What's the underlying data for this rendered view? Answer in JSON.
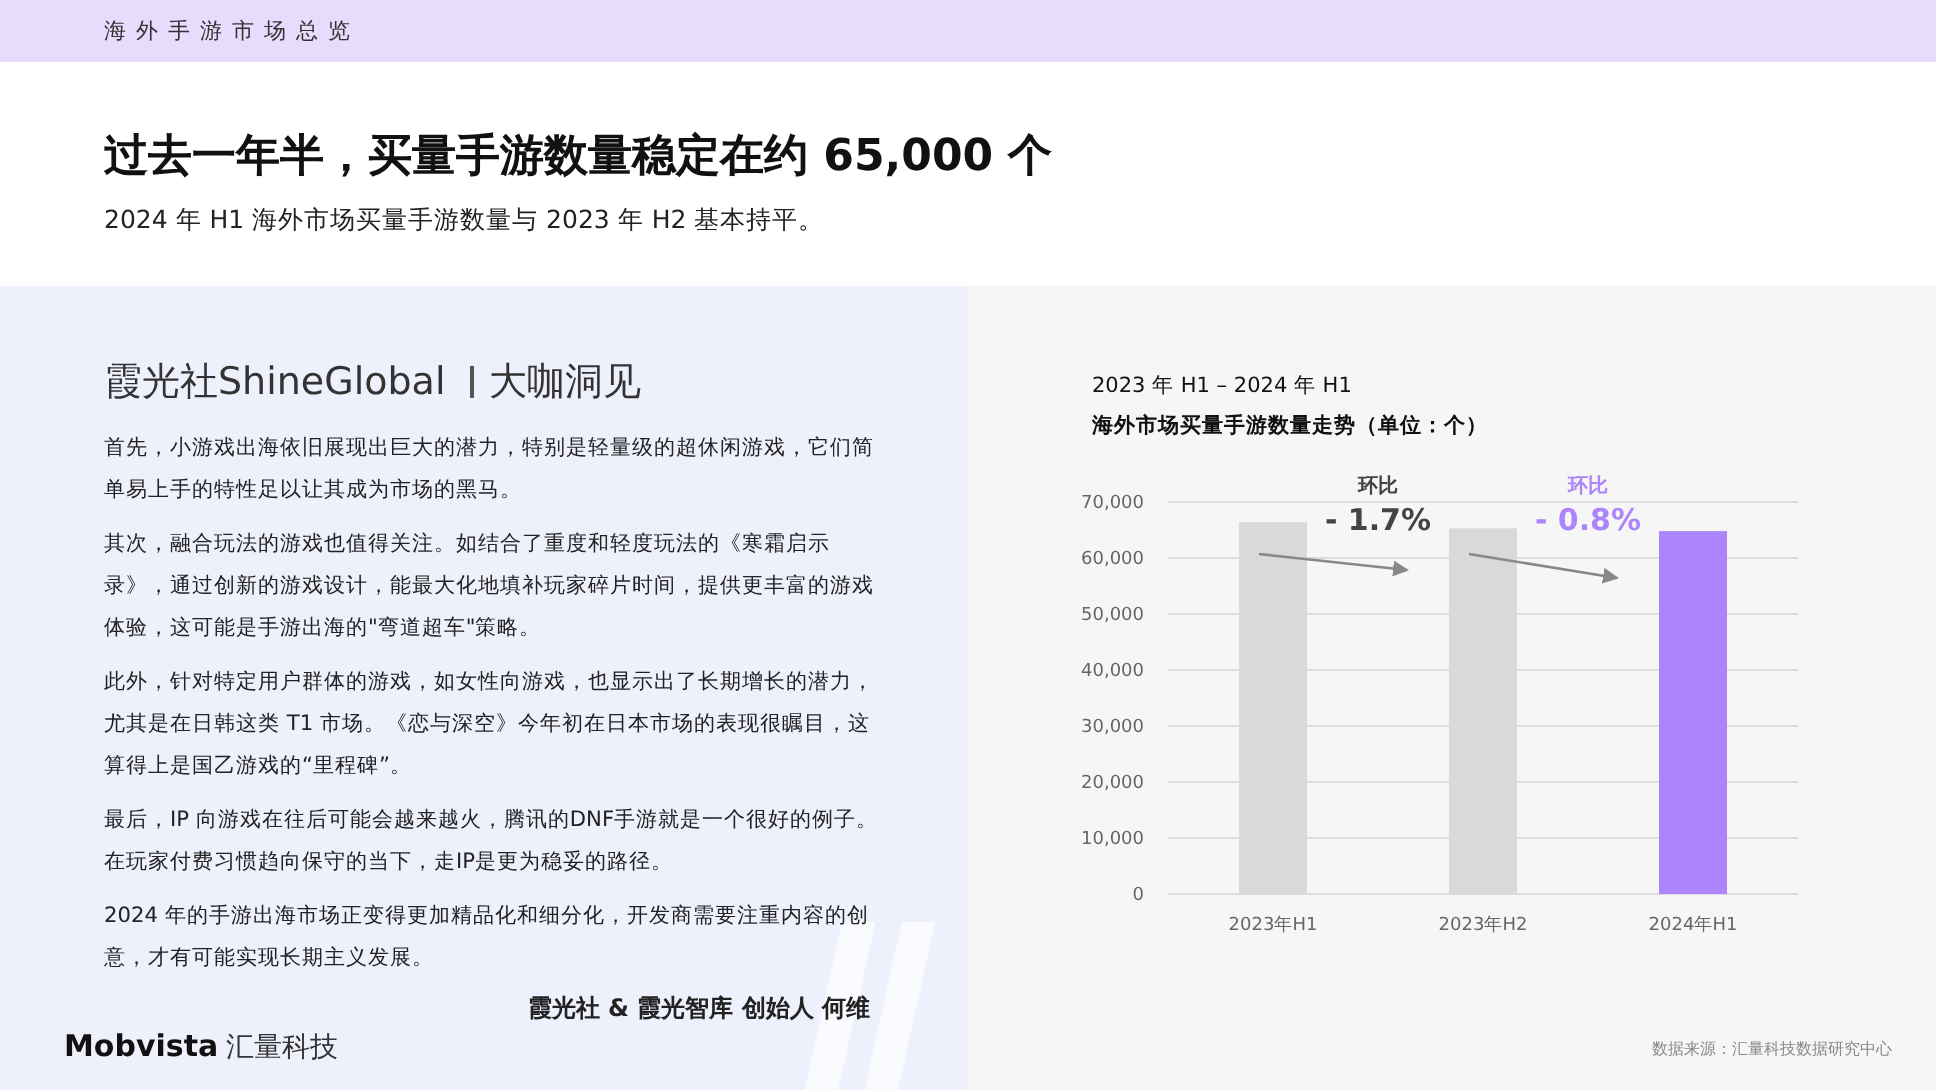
{
  "header": {
    "title": "海外手游市场总览"
  },
  "headline": {
    "title": "过去一年半，买量手游数量稳定在约 65,000 个",
    "subtitle": "2024 年 H1 海外市场买量手游数量与 2023 年 H2 基本持平。"
  },
  "insight": {
    "brand": "霞光社ShineGlobal",
    "column": "大咖洞见",
    "paragraphs": [
      "首先，小游戏出海依旧展现出巨大的潜力，特别是轻量级的超休闲游戏，它们简单易上手的特性足以让其成为市场的黑马。",
      "其次，融合玩法的游戏也值得关注。如结合了重度和轻度玩法的《寒霜启示录》，通过创新的游戏设计，能最大化地填补玩家碎片时间，提供更丰富的游戏体验，这可能是手游出海的\"弯道超车\"策略。",
      "此外，针对特定用户群体的游戏，如女性向游戏，也显示出了长期增长的潜力，尤其是在日韩这类 T1 市场。《恋与深空》今年初在日本市场的表现很瞩目，这算得上是国乙游戏的“里程碑”。",
      "最后，IP 向游戏在往后可能会越来越火，腾讯的DNF手游就是一个很好的例子。在玩家付费习惯趋向保守的当下，走IP是更为稳妥的路径。",
      "2024 年的手游出海市场正变得更加精品化和细分化，开发商需要注重内容的创意，才有可能实现长期主义发展。"
    ],
    "signature": "霞光社 & 霞光智库 创始人 何维"
  },
  "footer_logo": {
    "latin": "Mobvista",
    "chinese": "汇量科技"
  },
  "chart": {
    "title_lines": [
      "2023 年 H1 – 2024 年 H1",
      "海外市场买量手游数量走势（单位：个）"
    ],
    "chart_data": {
      "type": "bar",
      "categories": [
        "2023年H1",
        "2023年H2",
        "2024年H1"
      ],
      "series": [
        {
          "values": [
            66400,
            65300,
            64800
          ],
          "colors": [
            "#d9d9d9",
            "#d9d9d9",
            "#ad85fb"
          ]
        }
      ],
      "grid": true,
      "ylim": [
        0,
        70000
      ],
      "yticks": [
        {
          "value": 0,
          "label": "0"
        },
        {
          "value": 10000,
          "label": "10,000"
        },
        {
          "value": 20000,
          "label": "20,000"
        },
        {
          "value": 30000,
          "label": "30,000"
        },
        {
          "value": 40000,
          "label": "40,000"
        },
        {
          "value": 50000,
          "label": "50,000"
        },
        {
          "value": 60000,
          "label": "60,000"
        },
        {
          "value": 70000,
          "label": "70,000"
        }
      ]
    },
    "changes": [
      {
        "label": "环比",
        "value": "- 1.7%",
        "color": "#444444"
      },
      {
        "label": "环比",
        "value": "- 0.8%",
        "color": "#ad85fb"
      }
    ],
    "source": "数据来源：汇量科技数据研究中心"
  }
}
